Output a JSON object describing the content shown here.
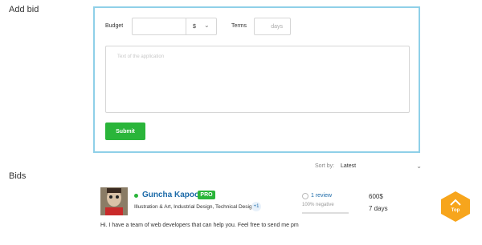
{
  "add_bid": {
    "title": "Add bid",
    "budget_label": "Budget",
    "budget_value": "",
    "currency_value": "$",
    "terms_label": "Terms",
    "terms_placeholder": "days",
    "textarea_placeholder": "Text of the application",
    "submit_label": "Submit"
  },
  "bids": {
    "title": "Bids",
    "sort_label": "Sort by:",
    "sort_value": "Latest",
    "items": [
      {
        "name": "Guncha Kapoor",
        "badge": "PRO",
        "skills": "Illustration & Art, Industrial Design, Technical Design",
        "skills_more": "+1",
        "reviews": "1 review",
        "negative": "100% negative",
        "price": "600$",
        "duration": "7 days",
        "message": "Hi. I have a team of web developers that can help you. Feel free to send me pm"
      }
    ]
  },
  "scroll_top": {
    "label": "Top"
  },
  "colors": {
    "accent_border": "#8fd0e8",
    "submit_green": "#2ab53a",
    "link_blue": "#1c6aa8",
    "top_button_orange": "#f7a51c"
  },
  "icons": [
    "chevron-down-icon",
    "online-dot-icon",
    "review-icon",
    "chevron-up-icon"
  ]
}
